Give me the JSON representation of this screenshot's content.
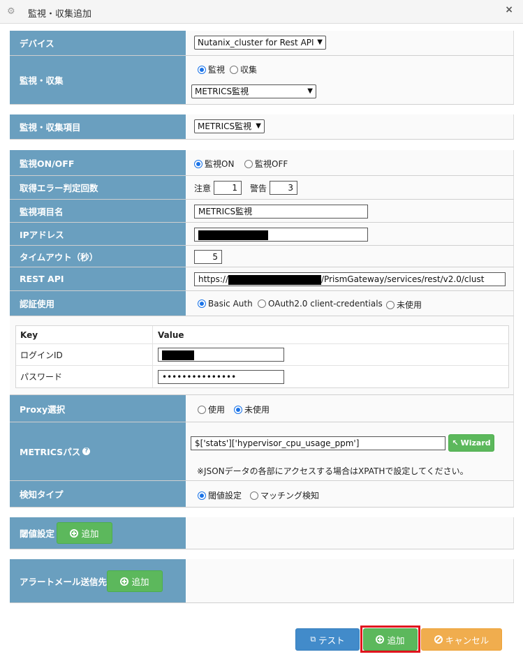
{
  "window": {
    "title": "監視・収集追加",
    "icon": "gear-icon",
    "close": "×"
  },
  "form": {
    "device": {
      "label": "デバイス",
      "value": "Nutanix_cluster for Rest API"
    },
    "monitor_collect": {
      "label": "監視・収集",
      "radio_monitor": "監視",
      "radio_collect": "収集",
      "selected": "監視",
      "type_value": "METRICS監視"
    },
    "item": {
      "label": "監視・収集項目",
      "value": "METRICS監視"
    },
    "onoff": {
      "label": "監視ON/OFF",
      "on": "監視ON",
      "off": "監視OFF",
      "selected": "監視ON"
    },
    "error_count": {
      "label": "取得エラー判定回数",
      "caution_label": "注意",
      "caution_value": "1",
      "warning_label": "警告",
      "warning_value": "3"
    },
    "item_name": {
      "label": "監視項目名",
      "value": "METRICS監視"
    },
    "ip": {
      "label": "IPアドレス"
    },
    "timeout": {
      "label": "タイムアウト（秒）",
      "value": "5"
    },
    "rest_api": {
      "label": "REST API",
      "prefix": "https://",
      "suffix": "/PrismGateway/services/rest/v2.0/clust"
    },
    "auth": {
      "label": "認証使用",
      "basic": "Basic Auth",
      "oauth": "OAuth2.0 client-credentials",
      "none": "未使用",
      "selected": "Basic Auth"
    },
    "kv_table": {
      "header_key": "Key",
      "header_value": "Value",
      "rows": [
        {
          "key": "ログインID",
          "value": ""
        },
        {
          "key": "パスワード",
          "value": "•••••••••••••••"
        }
      ]
    },
    "proxy": {
      "label": "Proxy選択",
      "use": "使用",
      "nouse": "未使用",
      "selected": "未使用"
    },
    "metrics_path": {
      "label": "METRICSパス",
      "value": "$['stats']['hypervisor_cpu_usage_ppm']",
      "wizard": "Wizard",
      "note": "※JSONデータの各部にアクセスする場合はXPATHで設定してください。"
    },
    "detect_type": {
      "label": "検知タイプ",
      "threshold": "閾値設定",
      "matching": "マッチング検知",
      "selected": "閾値設定"
    },
    "threshold_setting": {
      "label": "閾値設定",
      "add": "追加"
    },
    "alert_mail": {
      "label": "アラートメール送信先",
      "add": "追加"
    }
  },
  "footer": {
    "test": "テスト",
    "add": "追加",
    "cancel": "キャンセル"
  },
  "colors": {
    "label_bg": "#6a9fbf",
    "green": "#5cb85c",
    "blue": "#428bca",
    "orange": "#f0ad4e",
    "highlight": "#e0141e"
  }
}
